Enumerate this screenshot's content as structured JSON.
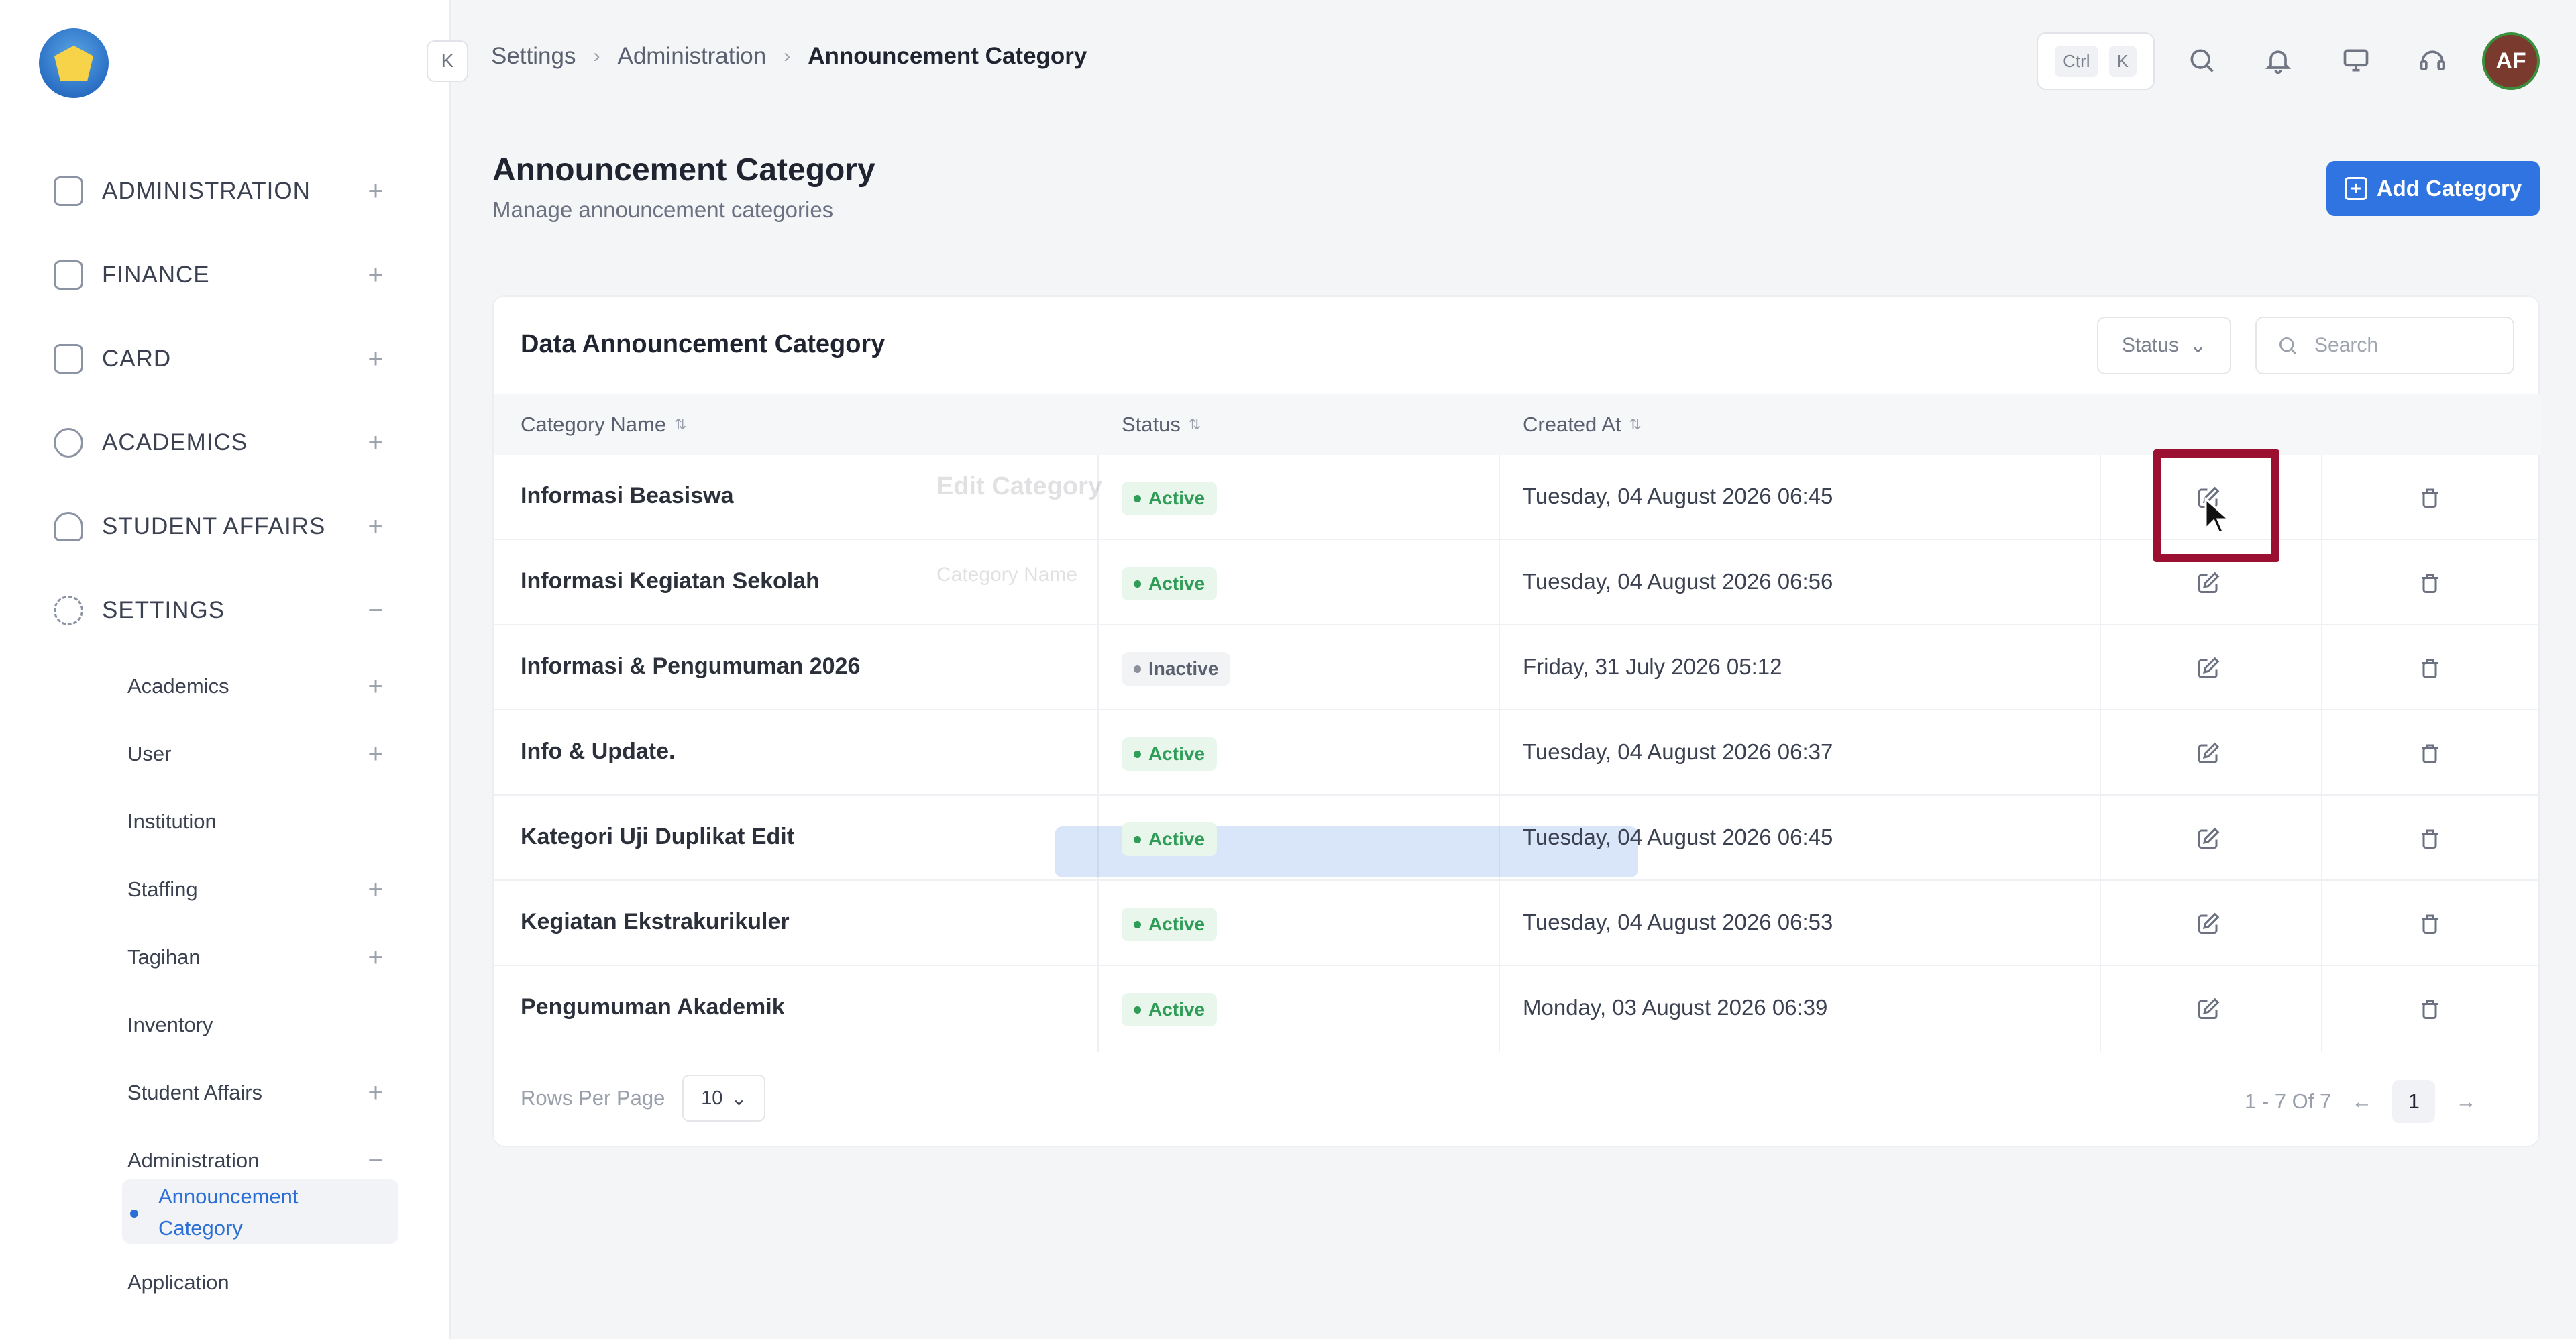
{
  "sidebar": {
    "groups": [
      {
        "label": "ADMINISTRATION",
        "toggle": "+"
      },
      {
        "label": "FINANCE",
        "toggle": "+"
      },
      {
        "label": "CARD",
        "toggle": "+"
      },
      {
        "label": "ACADEMICS",
        "toggle": "+"
      },
      {
        "label": "STUDENT AFFAIRS",
        "toggle": "+"
      },
      {
        "label": "SETTINGS",
        "toggle": "−"
      }
    ],
    "settings_items": [
      {
        "label": "Academics",
        "toggle": "+"
      },
      {
        "label": "User",
        "toggle": "+"
      },
      {
        "label": "Institution",
        "toggle": ""
      },
      {
        "label": "Staffing",
        "toggle": "+"
      },
      {
        "label": "Tagihan",
        "toggle": "+"
      },
      {
        "label": "Inventory",
        "toggle": ""
      },
      {
        "label": "Student Affairs",
        "toggle": "+"
      },
      {
        "label": "Administration",
        "toggle": "−"
      }
    ],
    "active_leaf": "Announcement Category",
    "after_leaf": "Application"
  },
  "topbar": {
    "collapse_icon": "K",
    "breadcrumb": [
      "Settings",
      "Administration",
      "Announcement Category"
    ],
    "shortcut": [
      "Ctrl",
      "K"
    ],
    "avatar_initials": "AF"
  },
  "page": {
    "title": "Announcement Category",
    "subtitle": "Manage announcement categories",
    "add_button": "Add Category"
  },
  "table": {
    "title": "Data Announcement Category",
    "status_filter": "Status",
    "search_placeholder": "Search",
    "columns": [
      "Category Name",
      "Status",
      "Created At"
    ],
    "rows": [
      {
        "name": "Informasi Beasiswa",
        "status": "Active",
        "created": "Tuesday, 04 August 2026 06:45"
      },
      {
        "name": "Informasi Kegiatan Sekolah",
        "status": "Active",
        "created": "Tuesday, 04 August 2026 06:56"
      },
      {
        "name": "Informasi & Pengumuman 2026",
        "status": "Inactive",
        "created": "Friday, 31 July 2026 05:12"
      },
      {
        "name": "Info & Update.",
        "status": "Active",
        "created": "Tuesday, 04 August 2026 06:37"
      },
      {
        "name": "Kategori Uji Duplikat Edit",
        "status": "Active",
        "created": "Tuesday, 04 August 2026 06:45"
      },
      {
        "name": "Kegiatan Ekstrakurikuler",
        "status": "Active",
        "created": "Tuesday, 04 August 2026 06:53"
      },
      {
        "name": "Pengumuman Akademik",
        "status": "Active",
        "created": "Monday, 03 August 2026 06:39"
      }
    ],
    "rows_per_page_label": "Rows Per Page",
    "rows_per_page": "10",
    "range": "1 - 7 Of 7",
    "current_page": "1",
    "prev": "←",
    "next": "→"
  },
  "ghost_modal": {
    "title": "Edit Category",
    "field_label": "Category Name"
  },
  "colors": {
    "accent": "#2f74e0",
    "highlight_box": "#9b1030",
    "active_badge": "#2f9d57"
  }
}
